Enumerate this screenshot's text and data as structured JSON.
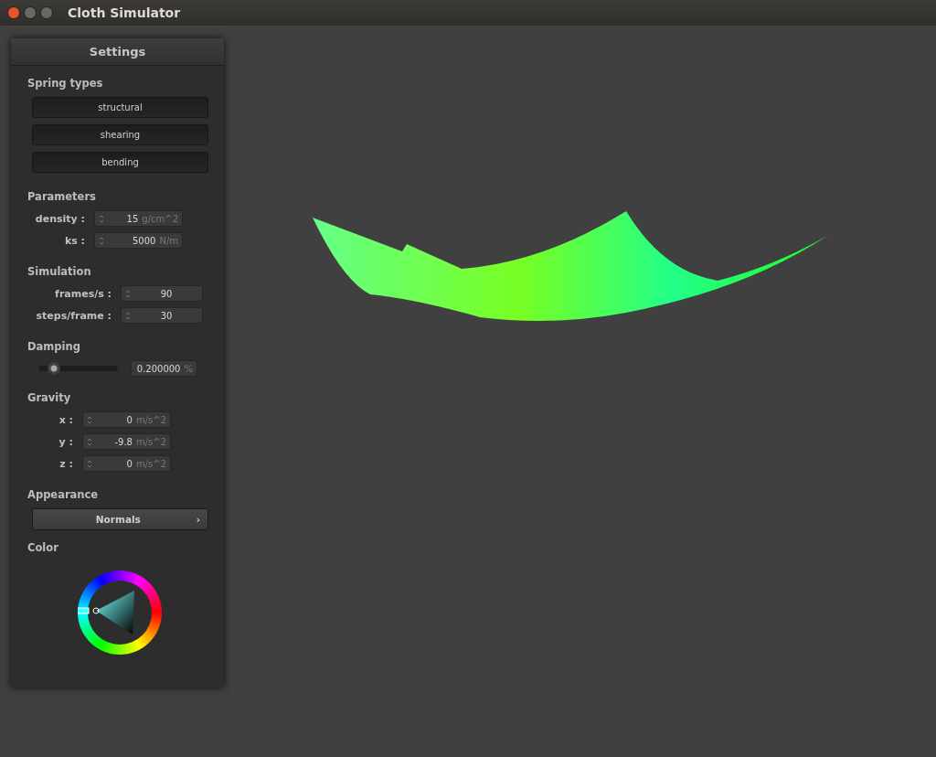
{
  "window": {
    "title": "Cloth Simulator"
  },
  "panel": {
    "title": "Settings",
    "sections": [
      {
        "kind": "toggles",
        "title": "Spring types",
        "items": [
          {
            "label": "structural",
            "on": true
          },
          {
            "label": "shearing",
            "on": true
          },
          {
            "label": "bending",
            "on": true
          }
        ]
      },
      {
        "kind": "fields",
        "title": "Parameters",
        "items": [
          {
            "label": "density :",
            "value": "15",
            "unit": "g/cm^2"
          },
          {
            "label": "ks :",
            "value": "5000",
            "unit": "N/m"
          }
        ]
      },
      {
        "kind": "fields",
        "title": "Simulation",
        "items": [
          {
            "label": "frames/s :",
            "value": "90"
          },
          {
            "label": "steps/frame :",
            "value": "30"
          }
        ]
      },
      {
        "kind": "slider",
        "title": "Damping",
        "level": 0.2,
        "value": "0.200000",
        "unit": "%"
      },
      {
        "kind": "fields",
        "title": "Gravity",
        "items": [
          {
            "label": "x :",
            "value": "0",
            "unit": "m/s^2"
          },
          {
            "label": "y :",
            "value": "-9.8",
            "unit": "m/s^2"
          },
          {
            "label": "z :",
            "value": "0",
            "unit": "m/s^2"
          }
        ]
      },
      {
        "kind": "dropdown",
        "title": "Appearance",
        "value": "Normals",
        "arrow": "›"
      },
      {
        "kind": "color",
        "title": "Color"
      }
    ]
  }
}
